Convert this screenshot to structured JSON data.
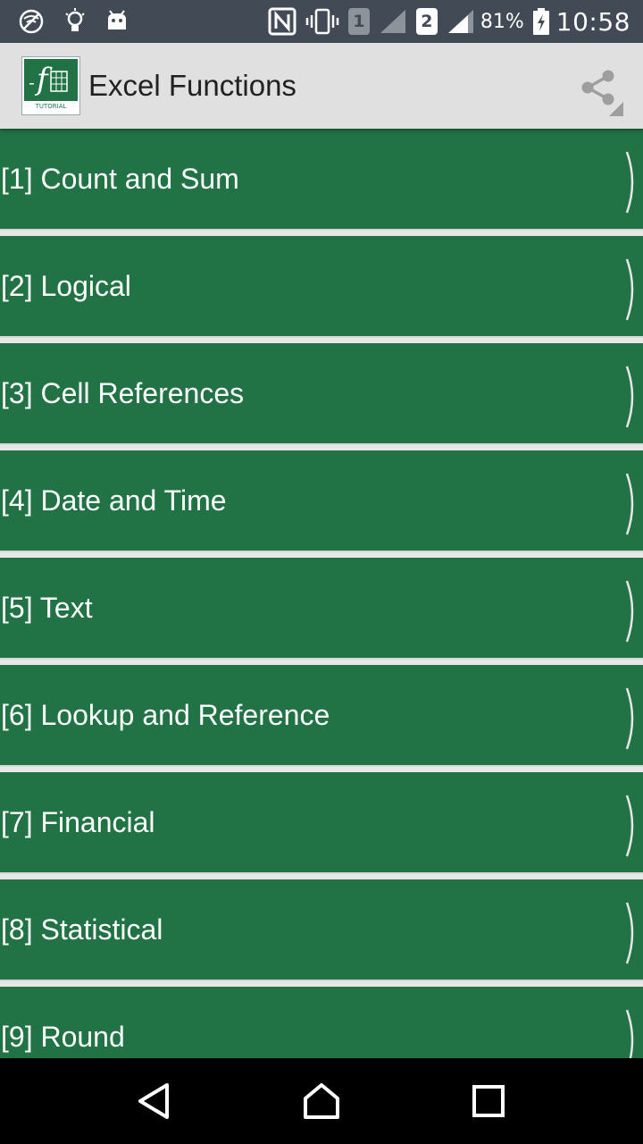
{
  "status_bar": {
    "sim1": "1",
    "sim2": "2",
    "battery": "81%",
    "time": "10:58",
    "icons": [
      "blocked-wifi-icon",
      "lightbulb-icon",
      "android-icon",
      "nfc-icon",
      "vibrate-icon",
      "signal-icon",
      "signal-icon",
      "battery-charging-icon"
    ]
  },
  "app_bar": {
    "title": "Excel Functions",
    "logo_caption": "TUTORIAL",
    "icons": [
      "app-logo-icon",
      "share-icon"
    ]
  },
  "list": {
    "items": [
      {
        "label": "[1] Count and Sum"
      },
      {
        "label": "[2] Logical"
      },
      {
        "label": "[3] Cell References"
      },
      {
        "label": "[4] Date and Time"
      },
      {
        "label": "[5] Text"
      },
      {
        "label": "[6] Lookup and Reference"
      },
      {
        "label": "[7] Financial"
      },
      {
        "label": "[8] Statistical"
      },
      {
        "label": "[9] Round"
      }
    ]
  },
  "nav_bar": {
    "icons": [
      "back-icon",
      "home-icon",
      "recents-icon"
    ]
  },
  "colors": {
    "status_bar_bg": "#414a55",
    "app_bar_bg": "#e0e0e0",
    "list_item_bg": "#217346",
    "list_text": "#ffffff",
    "nav_bar_bg": "#000000"
  }
}
